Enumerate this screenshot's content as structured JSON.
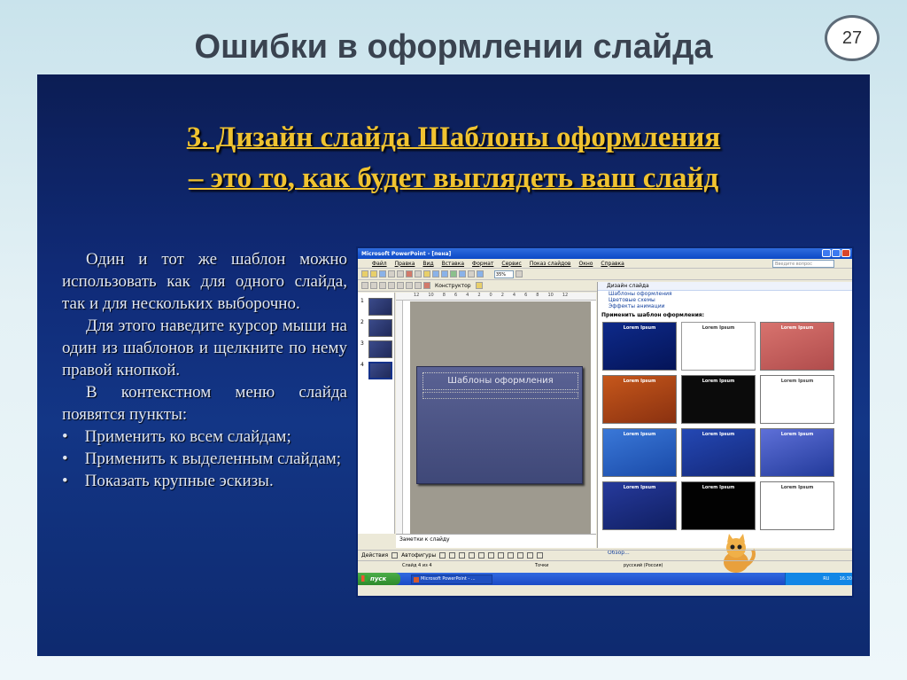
{
  "header": {
    "title": "Ошибки в оформлении слайда",
    "slide_number": "27"
  },
  "slide": {
    "heading_line1": "3. Дизайн слайда Шаблоны оформления",
    "heading_line2": "– это то, как будет выглядеть ваш слайд",
    "paragraphs": [
      "Один и тот же шаблон можно использовать как для одного слайда, так и для нескольких выборочно.",
      "Для этого наведите курсор мыши на один из шаблонов и щелкните по нему правой кнопкой.",
      "В контекстном меню слайда появятся пункты:"
    ],
    "bullets": [
      "Применить ко всем слайдам;",
      "Применить к выделенным слайдам;",
      "Показать крупные эскизы."
    ]
  },
  "screenshot": {
    "window_title": "Microsoft PowerPoint - [пена]",
    "menu": [
      "Файл",
      "Правка",
      "Вид",
      "Вставка",
      "Формат",
      "Сервис",
      "Показ слайдов",
      "Окно",
      "Справка"
    ],
    "help_placeholder": "Введите вопрос",
    "constructor_label": "Конструктор",
    "zoom": "35%",
    "ruler_numbers": [
      "12",
      "10",
      "8",
      "6",
      "4",
      "2",
      "0",
      "2",
      "4",
      "6",
      "8",
      "10",
      "12"
    ],
    "thumb_numbers": [
      "1",
      "2",
      "3",
      "4"
    ],
    "mini_slide_title": "Шаблоны оформления",
    "notes_placeholder": "Заметки к слайду",
    "task_pane_title": "Дизайн слайда",
    "task_links": [
      "Шаблоны оформления",
      "Цветовые схемы",
      "Эффекты анимации"
    ],
    "apply_template_label": "Применить шаблон оформления:",
    "template_caption": "Lorem Ipsum",
    "more_link": "Обзор...",
    "draw_menu": "Действия",
    "autoshapes_menu": "Автофигуры",
    "status_slide": "Слайд 4 из 4",
    "status_design": "Точки",
    "status_lang": "русский (Россия)",
    "start_label": "пуск",
    "taskbar_app": "Microsoft PowerPoint - ...",
    "tray_text": "RU",
    "tray_time": "16:30"
  },
  "colors": {
    "heading": "#f0c330",
    "slide_bg": "#102b78",
    "title": "#3a4350"
  }
}
